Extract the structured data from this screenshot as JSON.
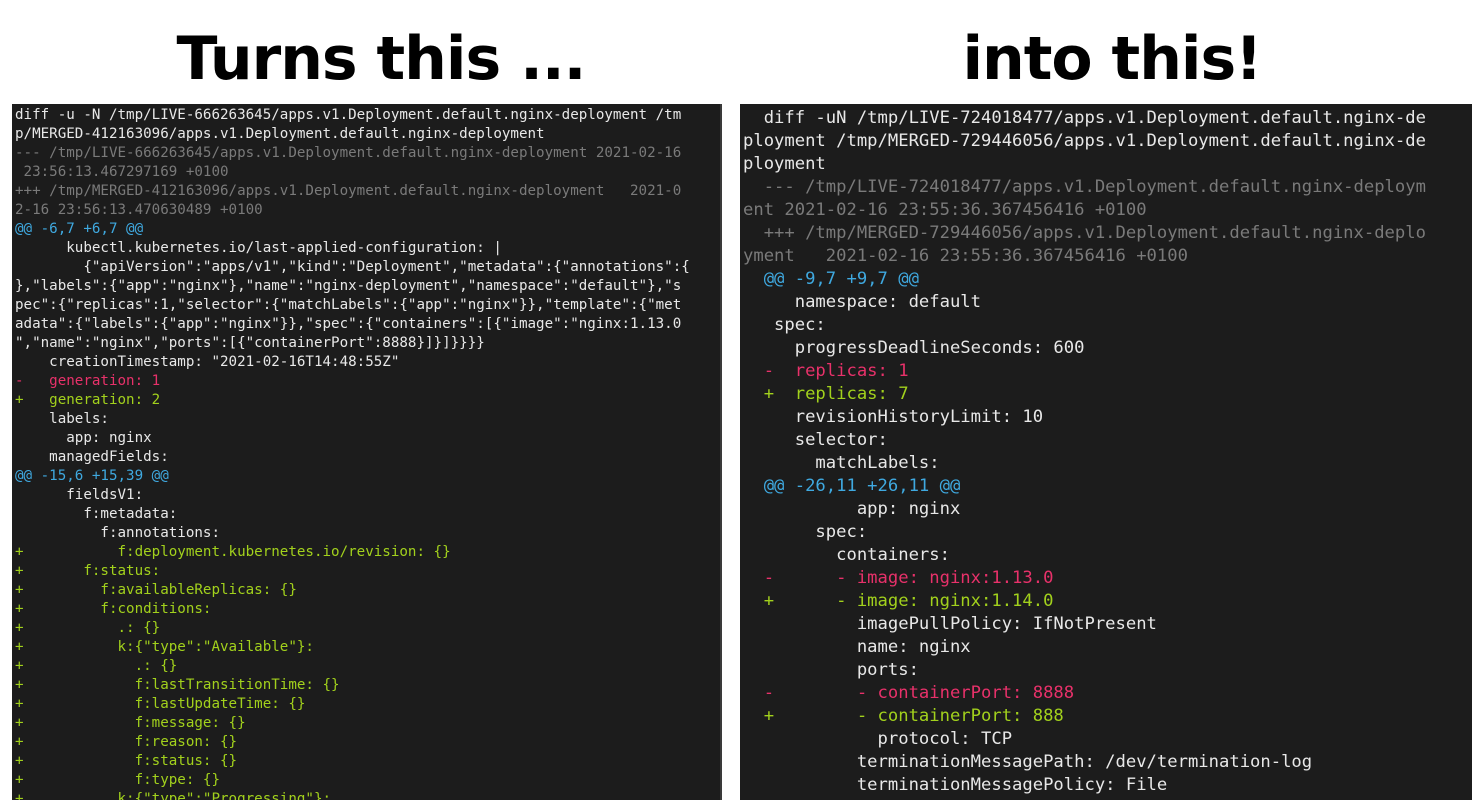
{
  "headings": {
    "left": "Turns this ...",
    "right": "into this!"
  },
  "colors": {
    "background": "#1c1c1c",
    "text": "#e8e8e8",
    "meta": "#7a7a7a",
    "hunk": "#3fa9e0",
    "removed": "#e8316a",
    "added": "#a2d11c"
  },
  "left_terminal": {
    "lines": [
      {
        "type": "normal",
        "text": "diff -u -N /tmp/LIVE-666263645/apps.v1.Deployment.default.nginx-deployment /tm"
      },
      {
        "type": "normal",
        "text": "p/MERGED-412163096/apps.v1.Deployment.default.nginx-deployment"
      },
      {
        "type": "meta",
        "text": "--- /tmp/LIVE-666263645/apps.v1.Deployment.default.nginx-deployment 2021-02-16"
      },
      {
        "type": "meta",
        "text": " 23:56:13.467297169 +0100"
      },
      {
        "type": "meta",
        "text": "+++ /tmp/MERGED-412163096/apps.v1.Deployment.default.nginx-deployment   2021-0"
      },
      {
        "type": "meta",
        "text": "2-16 23:56:13.470630489 +0100"
      },
      {
        "type": "hunk",
        "text": "@@ -6,7 +6,7 @@"
      },
      {
        "type": "normal",
        "text": "      kubectl.kubernetes.io/last-applied-configuration: |"
      },
      {
        "type": "normal",
        "text": "        {\"apiVersion\":\"apps/v1\",\"kind\":\"Deployment\",\"metadata\":{\"annotations\":{"
      },
      {
        "type": "normal",
        "text": "},\"labels\":{\"app\":\"nginx\"},\"name\":\"nginx-deployment\",\"namespace\":\"default\"},\"s"
      },
      {
        "type": "normal",
        "text": "pec\":{\"replicas\":1,\"selector\":{\"matchLabels\":{\"app\":\"nginx\"}},\"template\":{\"met"
      },
      {
        "type": "normal",
        "text": "adata\":{\"labels\":{\"app\":\"nginx\"}},\"spec\":{\"containers\":[{\"image\":\"nginx:1.13.0"
      },
      {
        "type": "normal",
        "text": "\",\"name\":\"nginx\",\"ports\":[{\"containerPort\":8888}]}]}}}}"
      },
      {
        "type": "normal",
        "text": "    creationTimestamp: \"2021-02-16T14:48:55Z\""
      },
      {
        "type": "del",
        "text": "-   generation: 1"
      },
      {
        "type": "add",
        "text": "+   generation: 2"
      },
      {
        "type": "normal",
        "text": "    labels:"
      },
      {
        "type": "normal",
        "text": "      app: nginx"
      },
      {
        "type": "normal",
        "text": "    managedFields:"
      },
      {
        "type": "hunk",
        "text": "@@ -15,6 +15,39 @@"
      },
      {
        "type": "normal",
        "text": "      fieldsV1:"
      },
      {
        "type": "normal",
        "text": "        f:metadata:"
      },
      {
        "type": "normal",
        "text": "          f:annotations:"
      },
      {
        "type": "add",
        "text": "+           f:deployment.kubernetes.io/revision: {}"
      },
      {
        "type": "add",
        "text": "+       f:status:"
      },
      {
        "type": "add",
        "text": "+         f:availableReplicas: {}"
      },
      {
        "type": "add",
        "text": "+         f:conditions:"
      },
      {
        "type": "add",
        "text": "+           .: {}"
      },
      {
        "type": "add",
        "text": "+           k:{\"type\":\"Available\"}:"
      },
      {
        "type": "add",
        "text": "+             .: {}"
      },
      {
        "type": "add",
        "text": "+             f:lastTransitionTime: {}"
      },
      {
        "type": "add",
        "text": "+             f:lastUpdateTime: {}"
      },
      {
        "type": "add",
        "text": "+             f:message: {}"
      },
      {
        "type": "add",
        "text": "+             f:reason: {}"
      },
      {
        "type": "add",
        "text": "+             f:status: {}"
      },
      {
        "type": "add",
        "text": "+             f:type: {}"
      },
      {
        "type": "add",
        "text": "+           k:{\"type\":\"Progressing\"}:"
      }
    ]
  },
  "right_terminal": {
    "lines": [
      {
        "type": "normal",
        "text": "  diff -uN /tmp/LIVE-724018477/apps.v1.Deployment.default.nginx-de"
      },
      {
        "type": "normal",
        "text": "ployment /tmp/MERGED-729446056/apps.v1.Deployment.default.nginx-de"
      },
      {
        "type": "normal",
        "text": "ployment"
      },
      {
        "type": "meta",
        "text": "  --- /tmp/LIVE-724018477/apps.v1.Deployment.default.nginx-deploym"
      },
      {
        "type": "meta",
        "text": "ent 2021-02-16 23:55:36.367456416 +0100"
      },
      {
        "type": "meta",
        "text": "  +++ /tmp/MERGED-729446056/apps.v1.Deployment.default.nginx-deplo"
      },
      {
        "type": "meta",
        "text": "yment   2021-02-16 23:55:36.367456416 +0100"
      },
      {
        "type": "hunk",
        "text": "  @@ -9,7 +9,7 @@"
      },
      {
        "type": "normal",
        "text": "     namespace: default"
      },
      {
        "type": "normal",
        "text": "   spec:"
      },
      {
        "type": "normal",
        "text": "     progressDeadlineSeconds: 600"
      },
      {
        "type": "del",
        "text": "  -  replicas: 1"
      },
      {
        "type": "add",
        "text": "  +  replicas: 7"
      },
      {
        "type": "normal",
        "text": "     revisionHistoryLimit: 10"
      },
      {
        "type": "normal",
        "text": "     selector:"
      },
      {
        "type": "normal",
        "text": "       matchLabels:"
      },
      {
        "type": "hunk",
        "text": "  @@ -26,11 +26,11 @@"
      },
      {
        "type": "normal",
        "text": "           app: nginx"
      },
      {
        "type": "normal",
        "text": "       spec:"
      },
      {
        "type": "normal",
        "text": "         containers:"
      },
      {
        "type": "del",
        "text": "  -      - image: nginx:1.13.0"
      },
      {
        "type": "add",
        "text": "  +      - image: nginx:1.14.0"
      },
      {
        "type": "normal",
        "text": "           imagePullPolicy: IfNotPresent"
      },
      {
        "type": "normal",
        "text": "           name: nginx"
      },
      {
        "type": "normal",
        "text": "           ports:"
      },
      {
        "type": "del",
        "text": "  -        - containerPort: 8888"
      },
      {
        "type": "add",
        "text": "  +        - containerPort: 888"
      },
      {
        "type": "normal",
        "text": "             protocol: TCP"
      },
      {
        "type": "normal",
        "text": "           terminationMessagePath: /dev/termination-log"
      },
      {
        "type": "normal",
        "text": "           terminationMessagePolicy: File"
      }
    ]
  }
}
